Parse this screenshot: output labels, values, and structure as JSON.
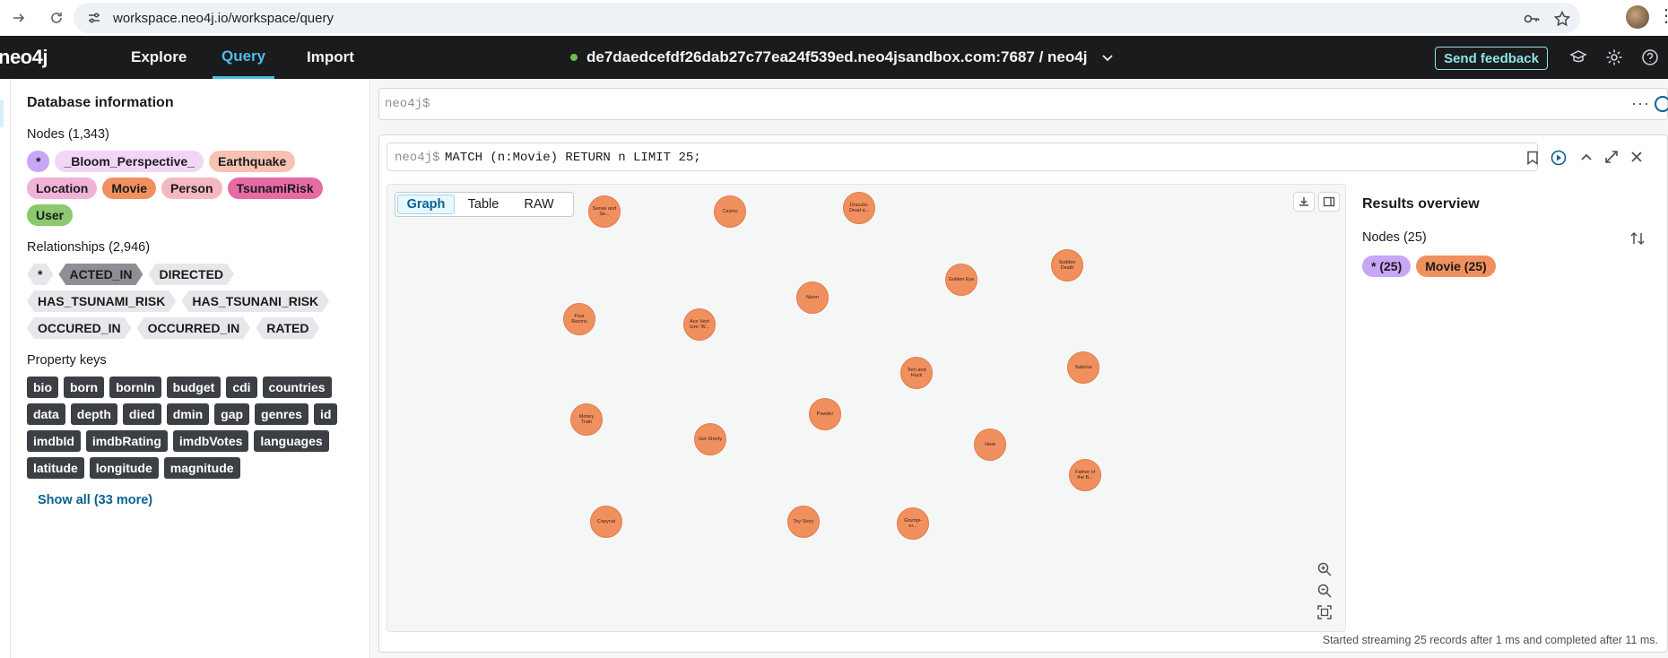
{
  "browser": {
    "url": "workspace.neo4j.io/workspace/query",
    "icons": [
      "arrow-forward-icon",
      "reload-icon",
      "site-settings-icon",
      "password-key-icon",
      "bookmark-star-icon",
      "profile-avatar",
      "menu-kebab-icon"
    ]
  },
  "topbar": {
    "logo": "neo4j",
    "tabs": [
      {
        "label": "Explore"
      },
      {
        "label": "Query"
      },
      {
        "label": "Import"
      }
    ],
    "active_tab": "Query",
    "connection": "de7daedcefdf26dab27c77ea24f539ed.neo4jsandbox.com:7687 / neo4j",
    "connection_status_color": "#6cc04a",
    "feedback_label": "Send feedback",
    "accent_color": "#4dbde8"
  },
  "sidebar": {
    "title": "Database information",
    "nodes_heading": "Nodes (1,343)",
    "node_labels": [
      {
        "label": "*",
        "color": "#c8a6f7"
      },
      {
        "label": "_Bloom_Perspective_",
        "color": "#f3d5f8"
      },
      {
        "label": "Earthquake",
        "color": "#f7c2b3"
      },
      {
        "label": "Location",
        "color": "#f0b2d6"
      },
      {
        "label": "Movie",
        "color": "#f0905f"
      },
      {
        "label": "Person",
        "color": "#f4b8c1"
      },
      {
        "label": "TsunamiRisk",
        "color": "#e86aa5"
      },
      {
        "label": "User",
        "color": "#8bc86e"
      }
    ],
    "relationships_heading": "Relationships (2,946)",
    "relationships": [
      "*",
      "ACTED_IN",
      "DIRECTED",
      "HAS_TSUNAMI_RISK",
      "HAS_TSUNANI_RISK",
      "OCCURED_IN",
      "OCCURRED_IN",
      "RATED"
    ],
    "property_keys_heading": "Property keys",
    "property_keys": [
      "bio",
      "born",
      "bornIn",
      "budget",
      "cdi",
      "countries",
      "data",
      "depth",
      "died",
      "dmin",
      "gap",
      "genres",
      "id",
      "imdbId",
      "imdbRating",
      "imdbVotes",
      "languages",
      "latitude",
      "longitude",
      "magnitude"
    ],
    "show_all": "Show all (33 more)"
  },
  "editor": {
    "prompt": "neo4j$",
    "more": "···"
  },
  "result_card": {
    "prompt": "neo4j$",
    "query": "MATCH (n:Movie) RETURN n LIMIT 25;",
    "view_tabs": [
      "Graph",
      "Table",
      "RAW"
    ],
    "active_view": "Graph",
    "graph_nodes": [
      {
        "caption": "Sense and Se..."
      },
      {
        "caption": "Casino"
      },
      {
        "caption": "Dracula: Dead a..."
      },
      {
        "caption": "Sudden Death"
      },
      {
        "caption": "Golden Eye"
      },
      {
        "caption": "Nixon"
      },
      {
        "caption": "Four Rooms"
      },
      {
        "caption": "Ace Vent ture: W..."
      },
      {
        "caption": "Sabrina"
      },
      {
        "caption": "Tom and Huck"
      },
      {
        "caption": "Money Train"
      },
      {
        "caption": "Powder"
      },
      {
        "caption": "Get Shorty"
      },
      {
        "caption": "Heat"
      },
      {
        "caption": "Father of the B..."
      },
      {
        "caption": "Copycat"
      },
      {
        "caption": "Toy Story"
      },
      {
        "caption": "Grumpi- er..."
      }
    ],
    "results_overview": {
      "title": "Results overview",
      "nodes_heading": "Nodes (25)",
      "chips": [
        {
          "label": "* (25)",
          "color": "#c8a6f7"
        },
        {
          "label": "Movie (25)",
          "color": "#f0905f"
        }
      ]
    },
    "status": "Started streaming 25 records after 1 ms and completed after 11 ms."
  }
}
